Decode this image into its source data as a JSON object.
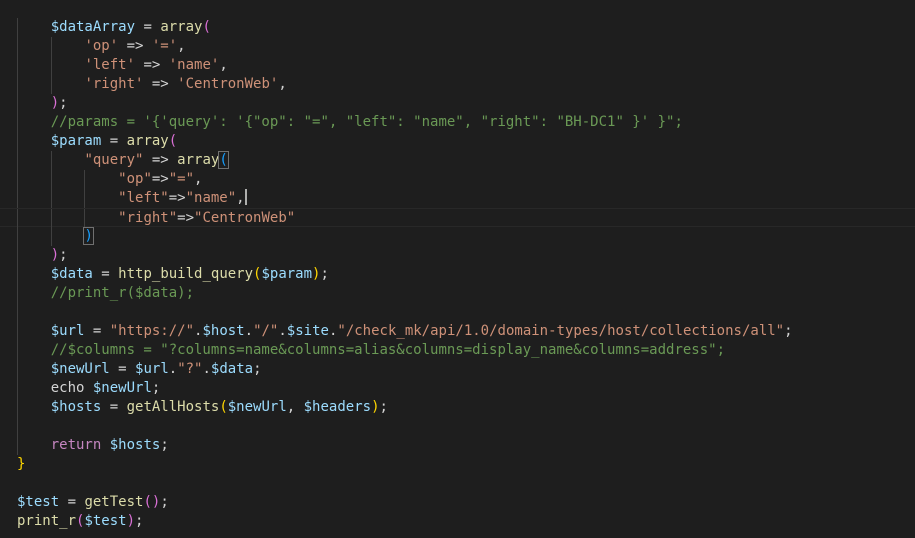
{
  "theme": {
    "background": "#1e1e1e",
    "variable": "#9cdcfe",
    "string": "#ce9178",
    "function": "#dcdcaa",
    "comment": "#6a9955",
    "keyword": "#c586c0",
    "plain": "#d4d4d4",
    "bracket_level1": "#da70d6",
    "bracket_level2": "#179fff",
    "bracket_level3": "#ffd700"
  },
  "editor": {
    "cursor_line": 10,
    "lines": [
      {
        "indent": 1,
        "tokens": [
          {
            "t": "$dataArray",
            "c": "var"
          },
          {
            "t": " = ",
            "c": "plain"
          },
          {
            "t": "array",
            "c": "fn"
          },
          {
            "t": "(",
            "c": "b1"
          }
        ]
      },
      {
        "indent": 2,
        "tokens": [
          {
            "t": "'op'",
            "c": "str"
          },
          {
            "t": " => ",
            "c": "plain"
          },
          {
            "t": "'='",
            "c": "str"
          },
          {
            "t": ",",
            "c": "plain"
          }
        ]
      },
      {
        "indent": 2,
        "tokens": [
          {
            "t": "'left'",
            "c": "str"
          },
          {
            "t": " => ",
            "c": "plain"
          },
          {
            "t": "'name'",
            "c": "str"
          },
          {
            "t": ",",
            "c": "plain"
          }
        ]
      },
      {
        "indent": 2,
        "tokens": [
          {
            "t": "'right'",
            "c": "str"
          },
          {
            "t": " => ",
            "c": "plain"
          },
          {
            "t": "'CentronWeb'",
            "c": "str"
          },
          {
            "t": ",",
            "c": "plain"
          }
        ]
      },
      {
        "indent": 1,
        "tokens": [
          {
            "t": ")",
            "c": "b1"
          },
          {
            "t": ";",
            "c": "plain"
          }
        ]
      },
      {
        "indent": 1,
        "tokens": [
          {
            "t": "//params = '{'query': '{\"op\": \"=\", \"left\": \"name\", \"right\": \"BH-DC1\" }' }\";",
            "c": "cmt"
          }
        ]
      },
      {
        "indent": 1,
        "tokens": [
          {
            "t": "$param",
            "c": "var"
          },
          {
            "t": " = ",
            "c": "plain"
          },
          {
            "t": "array",
            "c": "fn"
          },
          {
            "t": "(",
            "c": "b1"
          }
        ]
      },
      {
        "indent": 2,
        "tokens": [
          {
            "t": "\"query\"",
            "c": "str"
          },
          {
            "t": " => ",
            "c": "plain"
          },
          {
            "t": "array",
            "c": "fn"
          },
          {
            "t": "(",
            "c": "b2",
            "m": true
          }
        ]
      },
      {
        "indent": 3,
        "tokens": [
          {
            "t": "\"op\"",
            "c": "str"
          },
          {
            "t": "=>",
            "c": "plain"
          },
          {
            "t": "\"=\"",
            "c": "str"
          },
          {
            "t": ",",
            "c": "plain"
          }
        ]
      },
      {
        "indent": 3,
        "tokens": [
          {
            "t": "\"left\"",
            "c": "str"
          },
          {
            "t": "=>",
            "c": "plain"
          },
          {
            "t": "\"name\"",
            "c": "str"
          },
          {
            "t": ",",
            "c": "plain"
          },
          {
            "t": "",
            "c": "cursor"
          }
        ]
      },
      {
        "indent": 3,
        "tokens": [
          {
            "t": "\"right\"",
            "c": "str"
          },
          {
            "t": "=>",
            "c": "plain"
          },
          {
            "t": "\"CentronWeb\"",
            "c": "str"
          }
        ]
      },
      {
        "indent": 2,
        "tokens": [
          {
            "t": ")",
            "c": "b2",
            "m": true
          }
        ]
      },
      {
        "indent": 1,
        "tokens": [
          {
            "t": ")",
            "c": "b1"
          },
          {
            "t": ";",
            "c": "plain"
          }
        ]
      },
      {
        "indent": 1,
        "tokens": [
          {
            "t": "$data",
            "c": "var"
          },
          {
            "t": " = ",
            "c": "plain"
          },
          {
            "t": "http_build_query",
            "c": "fn"
          },
          {
            "t": "(",
            "c": "b3"
          },
          {
            "t": "$param",
            "c": "var"
          },
          {
            "t": ")",
            "c": "b3"
          },
          {
            "t": ";",
            "c": "plain"
          }
        ]
      },
      {
        "indent": 1,
        "tokens": [
          {
            "t": "//print_r($data);",
            "c": "cmt"
          }
        ]
      },
      {
        "indent": 0,
        "tokens": []
      },
      {
        "indent": 1,
        "tokens": [
          {
            "t": "$url",
            "c": "var"
          },
          {
            "t": " = ",
            "c": "plain"
          },
          {
            "t": "\"https://\"",
            "c": "str"
          },
          {
            "t": ".",
            "c": "plain"
          },
          {
            "t": "$host",
            "c": "var"
          },
          {
            "t": ".",
            "c": "plain"
          },
          {
            "t": "\"/\"",
            "c": "str"
          },
          {
            "t": ".",
            "c": "plain"
          },
          {
            "t": "$site",
            "c": "var"
          },
          {
            "t": ".",
            "c": "plain"
          },
          {
            "t": "\"/check_mk/api/1.0/domain-types/host/collections/all\"",
            "c": "str"
          },
          {
            "t": ";",
            "c": "plain"
          }
        ]
      },
      {
        "indent": 1,
        "tokens": [
          {
            "t": "//$columns = \"?columns=name&columns=alias&columns=display_name&columns=address\";",
            "c": "cmt"
          }
        ]
      },
      {
        "indent": 1,
        "tokens": [
          {
            "t": "$newUrl",
            "c": "var"
          },
          {
            "t": " = ",
            "c": "plain"
          },
          {
            "t": "$url",
            "c": "var"
          },
          {
            "t": ".",
            "c": "plain"
          },
          {
            "t": "\"?\"",
            "c": "str"
          },
          {
            "t": ".",
            "c": "plain"
          },
          {
            "t": "$data",
            "c": "var"
          },
          {
            "t": ";",
            "c": "plain"
          }
        ]
      },
      {
        "indent": 1,
        "tokens": [
          {
            "t": "echo",
            "c": "plain"
          },
          {
            "t": " ",
            "c": "plain"
          },
          {
            "t": "$newUrl",
            "c": "var"
          },
          {
            "t": ";",
            "c": "plain"
          }
        ]
      },
      {
        "indent": 1,
        "tokens": [
          {
            "t": "$hosts",
            "c": "var"
          },
          {
            "t": " = ",
            "c": "plain"
          },
          {
            "t": "getAllHosts",
            "c": "fn"
          },
          {
            "t": "(",
            "c": "b3"
          },
          {
            "t": "$newUrl",
            "c": "var"
          },
          {
            "t": ", ",
            "c": "plain"
          },
          {
            "t": "$headers",
            "c": "var"
          },
          {
            "t": ")",
            "c": "b3"
          },
          {
            "t": ";",
            "c": "plain"
          }
        ]
      },
      {
        "indent": 0,
        "tokens": []
      },
      {
        "indent": 1,
        "tokens": [
          {
            "t": "return",
            "c": "kw"
          },
          {
            "t": " ",
            "c": "plain"
          },
          {
            "t": "$hosts",
            "c": "var"
          },
          {
            "t": ";",
            "c": "plain"
          }
        ]
      },
      {
        "indent": 0,
        "tokens": [
          {
            "t": "}",
            "c": "b3"
          }
        ]
      },
      {
        "indent": 0,
        "tokens": []
      },
      {
        "indent": 0,
        "tokens": [
          {
            "t": "$test",
            "c": "var"
          },
          {
            "t": " = ",
            "c": "plain"
          },
          {
            "t": "getTest",
            "c": "fn"
          },
          {
            "t": "(",
            "c": "b1"
          },
          {
            "t": ")",
            "c": "b1"
          },
          {
            "t": ";",
            "c": "plain"
          }
        ]
      },
      {
        "indent": 0,
        "tokens": [
          {
            "t": "print_r",
            "c": "fn"
          },
          {
            "t": "(",
            "c": "b1"
          },
          {
            "t": "$test",
            "c": "var"
          },
          {
            "t": ")",
            "c": "b1"
          },
          {
            "t": ";",
            "c": "plain"
          }
        ]
      }
    ]
  }
}
